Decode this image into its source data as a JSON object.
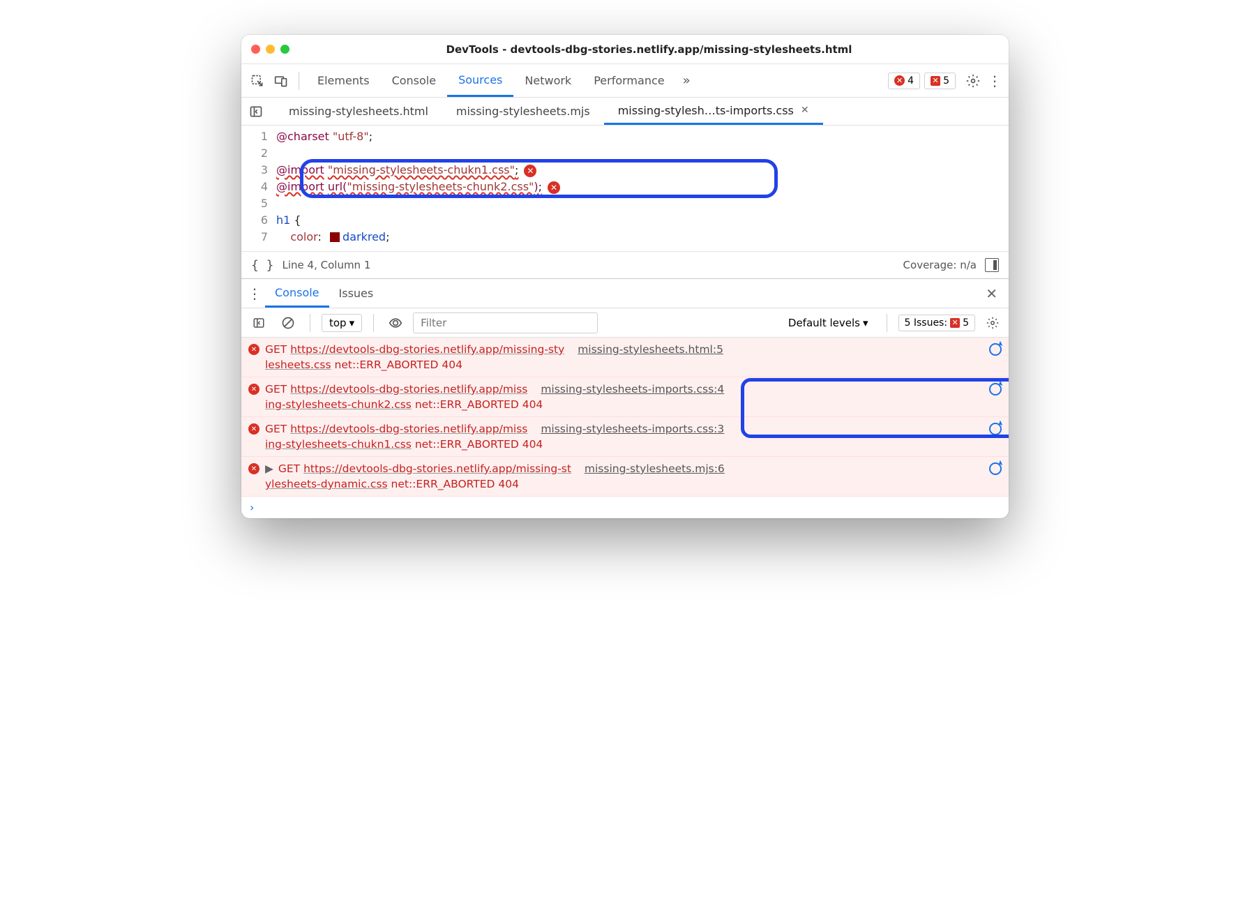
{
  "title": "DevTools - devtools-dbg-stories.netlify.app/missing-stylesheets.html",
  "panels": {
    "elements": "Elements",
    "console": "Console",
    "sources": "Sources",
    "network": "Network",
    "performance": "Performance"
  },
  "error_badge": "4",
  "warn_badge": "5",
  "file_tabs": {
    "t1": "missing-stylesheets.html",
    "t2": "missing-stylesheets.mjs",
    "t3": "missing-stylesh…ts-imports.css"
  },
  "code": {
    "l1_at": "@charset",
    "l1_str": "\"utf-8\"",
    "l3_at": "@import",
    "l3_str": "\"missing-stylesheets-chukn1.css\"",
    "l4_at": "@import",
    "l4_url": "url(",
    "l4_str": "\"missing-stylesheets-chunk2.css\"",
    "l4_close": ")",
    "l6_sel": "h1",
    "l6_brace": " {",
    "l7_prop": "color",
    "l7_val": "darkred",
    "semi": ";"
  },
  "gutter": [
    "1",
    "2",
    "3",
    "4",
    "5",
    "6",
    "7"
  ],
  "status": {
    "pos": "Line 4, Column 1",
    "coverage": "Coverage: n/a"
  },
  "drawer": {
    "console": "Console",
    "issues": "Issues"
  },
  "console_toolbar": {
    "top": "top",
    "filter_placeholder": "Filter",
    "levels": "Default levels",
    "issues_label": "5 Issues:",
    "issues_count": "5"
  },
  "messages": [
    {
      "get": "GET ",
      "url1": "https://devtools-dbg-stories.netlify.app/missing-sty",
      "url2": "lesheets.css",
      "err": " net::ERR_ABORTED 404",
      "src": "missing-stylesheets.html:5"
    },
    {
      "get": "GET ",
      "url1": "https://devtools-dbg-stories.netlify.app/miss",
      "url2": "ing-stylesheets-chunk2.css",
      "err": " net::ERR_ABORTED 404",
      "src": "missing-stylesheets-imports.css:4"
    },
    {
      "get": "GET ",
      "url1": "https://devtools-dbg-stories.netlify.app/miss",
      "url2": "ing-stylesheets-chukn1.css",
      "err": " net::ERR_ABORTED 404",
      "src": "missing-stylesheets-imports.css:3"
    },
    {
      "get": "GET ",
      "tri": "▶ ",
      "url1": "https://devtools-dbg-stories.netlify.app/missing-st",
      "url2": "ylesheets-dynamic.css",
      "err": " net::ERR_ABORTED 404",
      "src": "missing-stylesheets.mjs:6"
    }
  ]
}
